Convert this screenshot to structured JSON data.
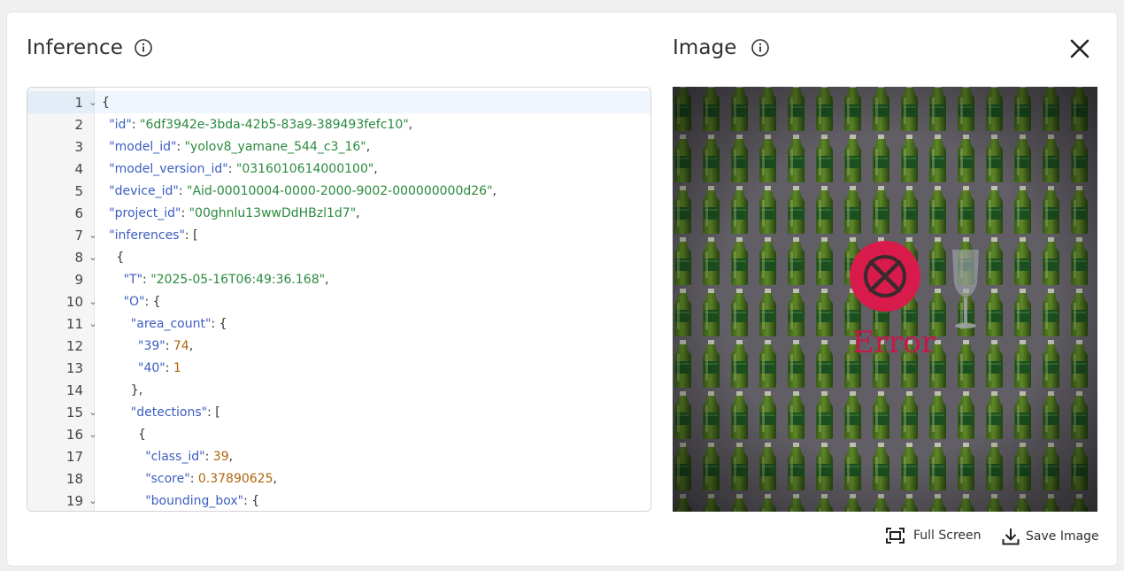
{
  "inference_panel": {
    "title": "Inference",
    "info_icon": "info-circle-icon"
  },
  "image_panel": {
    "title": "Image",
    "info_icon": "info-circle-icon",
    "close_icon": "close-icon",
    "error_label": "Error",
    "error_icon": "error-circle-x-icon",
    "error_color": "#d81b4a"
  },
  "editor": {
    "lines": [
      {
        "n": "1",
        "fold": true,
        "indent": 0,
        "parts": [
          {
            "t": "{",
            "c": "pun"
          }
        ]
      },
      {
        "n": "2",
        "fold": false,
        "indent": 1,
        "parts": [
          {
            "t": "\"id\"",
            "c": "key"
          },
          {
            "t": ": ",
            "c": "pun"
          },
          {
            "t": "\"6df3942e-3bda-42b5-83a9-389493fefc10\"",
            "c": "str"
          },
          {
            "t": ",",
            "c": "pun"
          }
        ]
      },
      {
        "n": "3",
        "fold": false,
        "indent": 1,
        "parts": [
          {
            "t": "\"model_id\"",
            "c": "key"
          },
          {
            "t": ": ",
            "c": "pun"
          },
          {
            "t": "\"yolov8_yamane_544_c3_16\"",
            "c": "str"
          },
          {
            "t": ",",
            "c": "pun"
          }
        ]
      },
      {
        "n": "4",
        "fold": false,
        "indent": 1,
        "parts": [
          {
            "t": "\"model_version_id\"",
            "c": "key"
          },
          {
            "t": ": ",
            "c": "pun"
          },
          {
            "t": "\"0316010614000100\"",
            "c": "str"
          },
          {
            "t": ",",
            "c": "pun"
          }
        ]
      },
      {
        "n": "5",
        "fold": false,
        "indent": 1,
        "parts": [
          {
            "t": "\"device_id\"",
            "c": "key"
          },
          {
            "t": ": ",
            "c": "pun"
          },
          {
            "t": "\"Aid-00010004-0000-2000-9002-000000000d26\"",
            "c": "str"
          },
          {
            "t": ",",
            "c": "pun"
          }
        ]
      },
      {
        "n": "6",
        "fold": false,
        "indent": 1,
        "parts": [
          {
            "t": "\"project_id\"",
            "c": "key"
          },
          {
            "t": ": ",
            "c": "pun"
          },
          {
            "t": "\"00ghnlu13wwDdHBzl1d7\"",
            "c": "str"
          },
          {
            "t": ",",
            "c": "pun"
          }
        ]
      },
      {
        "n": "7",
        "fold": true,
        "indent": 1,
        "parts": [
          {
            "t": "\"inferences\"",
            "c": "key"
          },
          {
            "t": ": [",
            "c": "pun"
          }
        ]
      },
      {
        "n": "8",
        "fold": true,
        "indent": 2,
        "parts": [
          {
            "t": "{",
            "c": "pun"
          }
        ]
      },
      {
        "n": "9",
        "fold": false,
        "indent": 3,
        "parts": [
          {
            "t": "\"T\"",
            "c": "key"
          },
          {
            "t": ": ",
            "c": "pun"
          },
          {
            "t": "\"2025-05-16T06:49:36.168\"",
            "c": "str"
          },
          {
            "t": ",",
            "c": "pun"
          }
        ]
      },
      {
        "n": "10",
        "fold": true,
        "indent": 3,
        "parts": [
          {
            "t": "\"O\"",
            "c": "key"
          },
          {
            "t": ": {",
            "c": "pun"
          }
        ]
      },
      {
        "n": "11",
        "fold": true,
        "indent": 4,
        "parts": [
          {
            "t": "\"area_count\"",
            "c": "key"
          },
          {
            "t": ": {",
            "c": "pun"
          }
        ]
      },
      {
        "n": "12",
        "fold": false,
        "indent": 5,
        "parts": [
          {
            "t": "\"39\"",
            "c": "key"
          },
          {
            "t": ": ",
            "c": "pun"
          },
          {
            "t": "74",
            "c": "num"
          },
          {
            "t": ",",
            "c": "pun"
          }
        ]
      },
      {
        "n": "13",
        "fold": false,
        "indent": 5,
        "parts": [
          {
            "t": "\"40\"",
            "c": "key"
          },
          {
            "t": ": ",
            "c": "pun"
          },
          {
            "t": "1",
            "c": "num"
          }
        ]
      },
      {
        "n": "14",
        "fold": false,
        "indent": 4,
        "parts": [
          {
            "t": "},",
            "c": "pun"
          }
        ]
      },
      {
        "n": "15",
        "fold": true,
        "indent": 4,
        "parts": [
          {
            "t": "\"detections\"",
            "c": "key"
          },
          {
            "t": ": [",
            "c": "pun"
          }
        ]
      },
      {
        "n": "16",
        "fold": true,
        "indent": 5,
        "parts": [
          {
            "t": "{",
            "c": "pun"
          }
        ]
      },
      {
        "n": "17",
        "fold": false,
        "indent": 6,
        "parts": [
          {
            "t": "\"class_id\"",
            "c": "key"
          },
          {
            "t": ": ",
            "c": "pun"
          },
          {
            "t": "39",
            "c": "num"
          },
          {
            "t": ",",
            "c": "pun"
          }
        ]
      },
      {
        "n": "18",
        "fold": false,
        "indent": 6,
        "parts": [
          {
            "t": "\"score\"",
            "c": "key"
          },
          {
            "t": ": ",
            "c": "pun"
          },
          {
            "t": "0.37890625",
            "c": "num"
          },
          {
            "t": ",",
            "c": "pun"
          }
        ]
      },
      {
        "n": "19",
        "fold": true,
        "indent": 6,
        "parts": [
          {
            "t": "\"bounding_box\"",
            "c": "key"
          },
          {
            "t": ": {",
            "c": "pun"
          }
        ]
      }
    ]
  },
  "footer": {
    "full_screen_label": "Full Screen",
    "full_screen_icon": "fullscreen-icon",
    "save_image_label": "Save Image",
    "save_image_icon": "download-icon"
  }
}
